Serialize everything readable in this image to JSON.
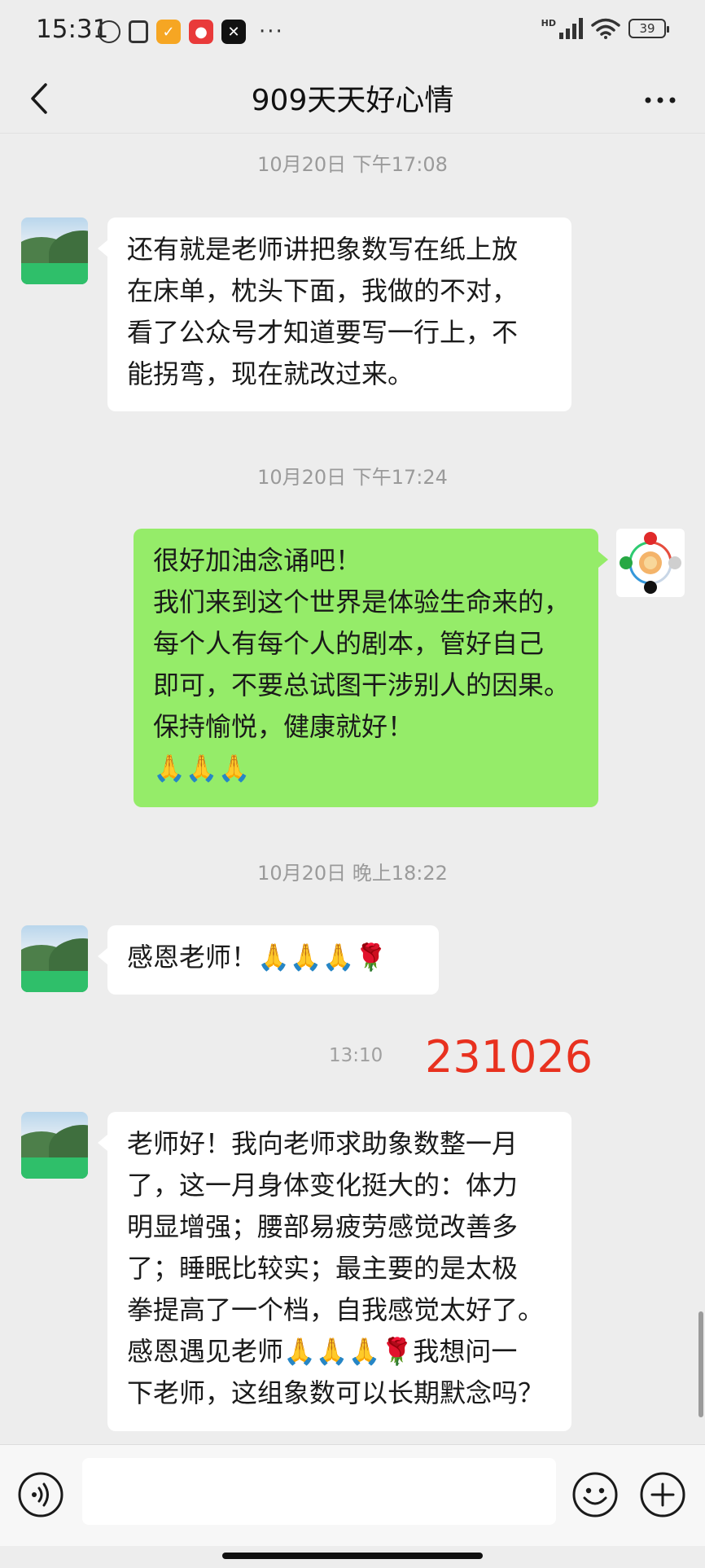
{
  "status_bar": {
    "time": "15:31",
    "network": "HD",
    "battery": "39",
    "more": "···"
  },
  "header": {
    "title": "909天天好心情"
  },
  "messages": [
    {
      "timestamp": "10月20日 下午17:08",
      "side": "left",
      "text": "还有就是老师讲把象数写在纸上放\n在床单，枕头下面，我做的不对，\n看了公众号才知道要写一行上，不\n能拐弯，现在就改过来。"
    },
    {
      "timestamp": "10月20日 下午17:24",
      "side": "right",
      "text": "很好加油念诵吧！\n我们来到这个世界是体验生命来的，\n每个人有每个人的剧本，管好自己\n即可，不要总试图干涉别人的因果。\n保持愉悦，健康就好！\n🙏🙏🙏"
    },
    {
      "timestamp": "10月20日 晚上18:22",
      "side": "left",
      "text": "感恩老师！🙏🙏🙏🌹"
    },
    {
      "timestamp": "13:10",
      "stamp": "231026",
      "side": "left",
      "text": "老师好！我向老师求助象数整一月\n了，这一月身体变化挺大的：体力\n明显增强；腰部易疲劳感觉改善多\n了；睡眠比较实；最主要的是太极\n拳提高了一个档，自我感觉太好了。\n感恩遇见老师🙏🙏🙏🌹我想问一\n下老师，这组象数可以长期默念吗？"
    }
  ],
  "input_bar": {
    "value": "",
    "placeholder": ""
  },
  "colors": {
    "background": "#ededed",
    "self_bubble": "#95ec69",
    "other_bubble": "#ffffff",
    "stamp_number": "#e8311f"
  },
  "icons": {
    "back": "back-arrow-icon",
    "more": "more-dots-icon",
    "voice": "voice-icon",
    "emoji": "emoji-icon",
    "plus": "plus-icon"
  }
}
